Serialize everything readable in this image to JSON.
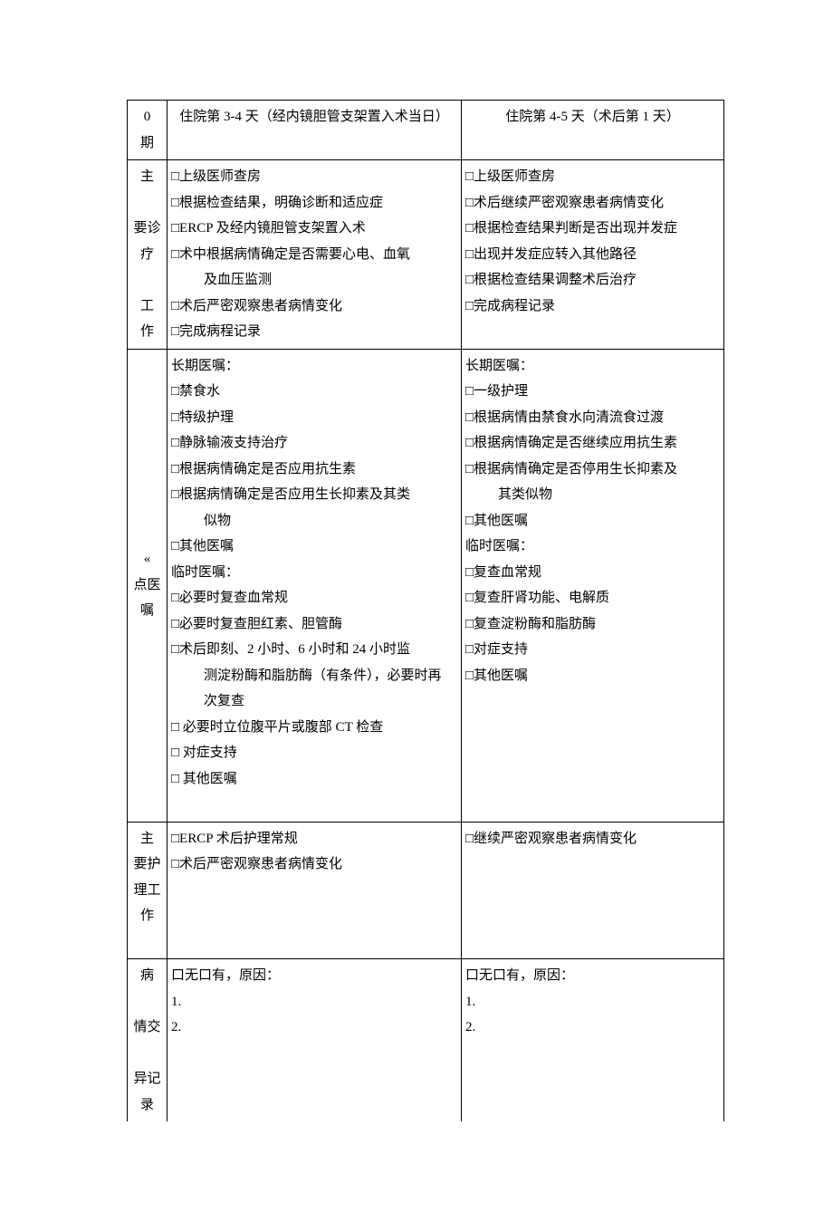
{
  "header": {
    "col0_line1": "0",
    "col0_line2": "期",
    "day1": "住院第 3-4 天（经内镜胆管支架置入术当日）",
    "day2": "住院第 4-5 天（术后第 1 天）"
  },
  "rows": {
    "main_work": {
      "label_l1": "主",
      "label_l2": "要诊",
      "label_l3": "疗",
      "label_l4": "工",
      "label_l5": "作",
      "d1": {
        "i1": "□上级医师查房",
        "i2": "□根据检查结果，明确诊断和适应症",
        "i3": "□ERCP 及经内镜胆管支架置入术",
        "i4": "□术中根据病情确定是否需要心电、血氧",
        "i5_indent": "及血压监测",
        "i6": "□术后严密观察患者病情变化",
        "i7": "□完成病程记录"
      },
      "d2": {
        "i1": "□上级医师查房",
        "i2": "□术后继续严密观察患者病情变化",
        "i3": "□根据检查结果判断是否出现并发症",
        "i4": "□出现并发症应转入其他路径",
        "i5": "□根据检查结果调整术后治疗",
        "i6": "□完成病程记录"
      }
    },
    "orders": {
      "label_l1": "«",
      "label_l2": "点医",
      "label_l3": "嘱",
      "d1": {
        "long_hdr": "长期医嘱：",
        "l1": "□禁食水",
        "l2": "□特级护理",
        "l3": "□静脉输液支持治疗",
        "l4": "□根据病情确定是否应用抗生素",
        "l5": "□根据病情确定是否应用生长抑素及其类",
        "l5b_indent": "似物",
        "l6": "□其他医嘱",
        "temp_hdr": "临时医嘱：",
        "t1": "□必要时复查血常规",
        "t2": "□必要时复查胆红素、胆管酶",
        "t3a": "□术后即刻、2 小时、6 小时和 24 小时监",
        "t3b_indent": "测淀粉酶和脂肪酶（有条件），必要时再",
        "t3c_indent": "次复查",
        "t4": "□ 必要时立位腹平片或腹部 CT 检查",
        "t5": "□ 对症支持",
        "t6": "□ 其他医嘱"
      },
      "d2": {
        "long_hdr": "长期医嘱：",
        "l1": "□一级护理",
        "l2": "□根据病情由禁食水向清流食过渡",
        "l3": "□根据病情确定是否继续应用抗生素",
        "l4": "□根据病情确定是否停用生长抑素及",
        "l4b_indent": "其类似物",
        "l5": "□其他医嘱",
        "temp_hdr": "临时医嘱：",
        "t1": "□复查血常规",
        "t2": "□复查肝肾功能、电解质",
        "t3": "□复查淀粉酶和脂肪酶",
        "t4": "□对症支持",
        "t5": "□其他医嘱"
      }
    },
    "nursing": {
      "label_l1": "主",
      "label_l2": "要护",
      "label_l3": "理工",
      "label_l4": "作",
      "d1": {
        "n1": "□ERCP 术后护理常规",
        "n2": "□术后严密观察患者病情变化"
      },
      "d2": {
        "n1": "□继续严密观察患者病情变化"
      }
    },
    "variance": {
      "label_l1": "病",
      "label_l2": "情交",
      "label_l3": "异记",
      "label_l4": "录",
      "d1": {
        "v1": "口无口有，原因：",
        "v2": "1.",
        "v3": "2."
      },
      "d2": {
        "v1": "口无口有，原因：",
        "v2": "1.",
        "v3": "2."
      }
    }
  }
}
